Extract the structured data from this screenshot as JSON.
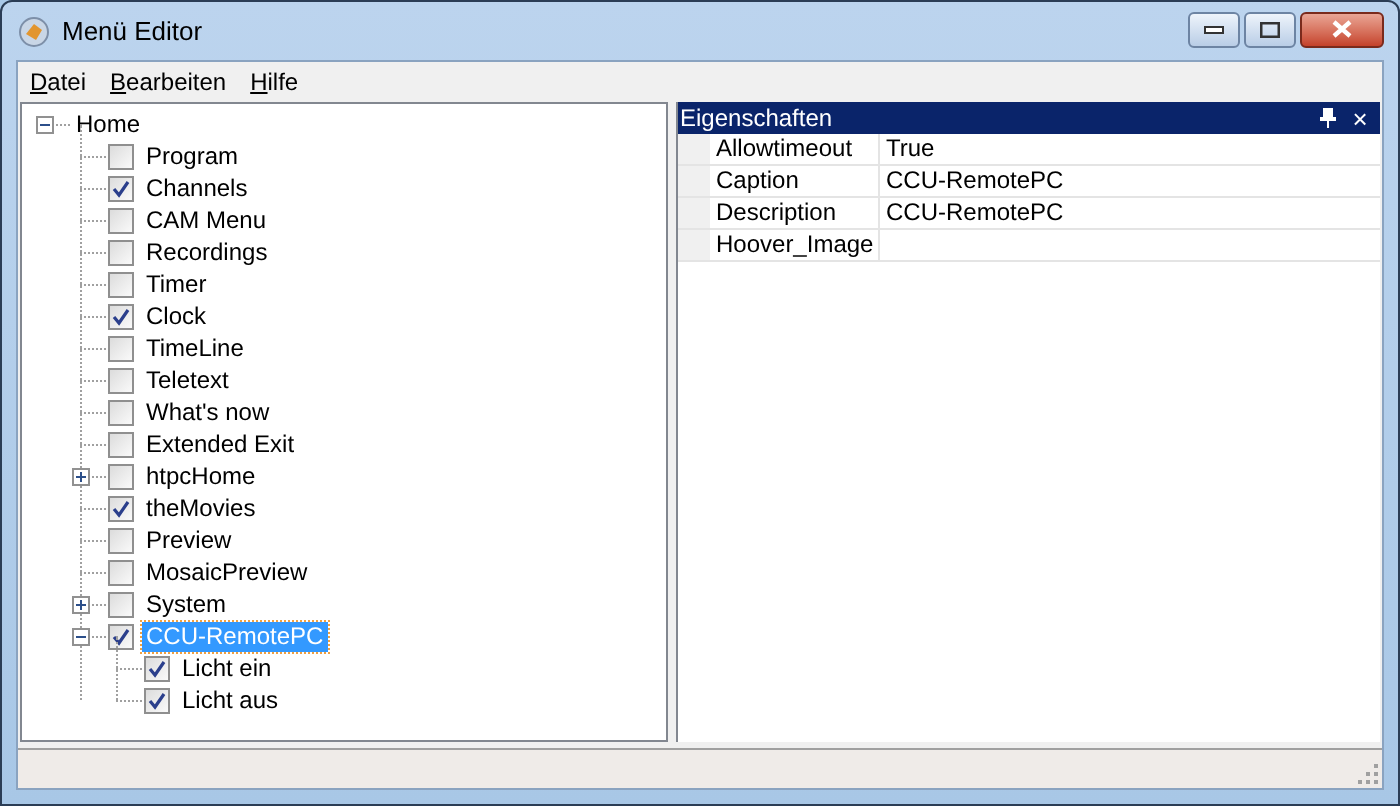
{
  "window": {
    "title": "Menü Editor"
  },
  "menu": [
    "Datei",
    "Bearbeiten",
    "Hilfe"
  ],
  "tree": {
    "label": "Home",
    "expanded": true,
    "selected": false,
    "children": [
      {
        "label": "Program",
        "checked": false,
        "selected": false
      },
      {
        "label": "Channels",
        "checked": true,
        "selected": false
      },
      {
        "label": "CAM Menu",
        "checked": false,
        "selected": false
      },
      {
        "label": "Recordings",
        "checked": false,
        "selected": false
      },
      {
        "label": "Timer",
        "checked": false,
        "selected": false
      },
      {
        "label": "Clock",
        "checked": true,
        "selected": false
      },
      {
        "label": "TimeLine",
        "checked": false,
        "selected": false
      },
      {
        "label": "Teletext",
        "checked": false,
        "selected": false
      },
      {
        "label": "What's now",
        "checked": false,
        "selected": false
      },
      {
        "label": "Extended Exit",
        "checked": false,
        "selected": false
      },
      {
        "label": "htpcHome",
        "checked": false,
        "selected": false,
        "expanded": false
      },
      {
        "label": "theMovies",
        "checked": true,
        "selected": false
      },
      {
        "label": "Preview",
        "checked": false,
        "selected": false
      },
      {
        "label": "MosaicPreview",
        "checked": false,
        "selected": false
      },
      {
        "label": "System",
        "checked": false,
        "selected": false,
        "expanded": false
      },
      {
        "label": "CCU-RemotePC",
        "checked": true,
        "selected": true,
        "expanded": true,
        "children": [
          {
            "label": "Licht ein",
            "checked": true,
            "selected": false
          },
          {
            "label": "Licht aus",
            "checked": true,
            "selected": false
          }
        ]
      }
    ]
  },
  "properties": {
    "title": "Eigenschaften",
    "close": "×",
    "rows": [
      {
        "name": "Allowtimeout",
        "value": "True"
      },
      {
        "name": "Caption",
        "value": "CCU-RemotePC"
      },
      {
        "name": "Description",
        "value": "CCU-RemotePC"
      },
      {
        "name": "Hoover_Image"
      }
    ]
  }
}
